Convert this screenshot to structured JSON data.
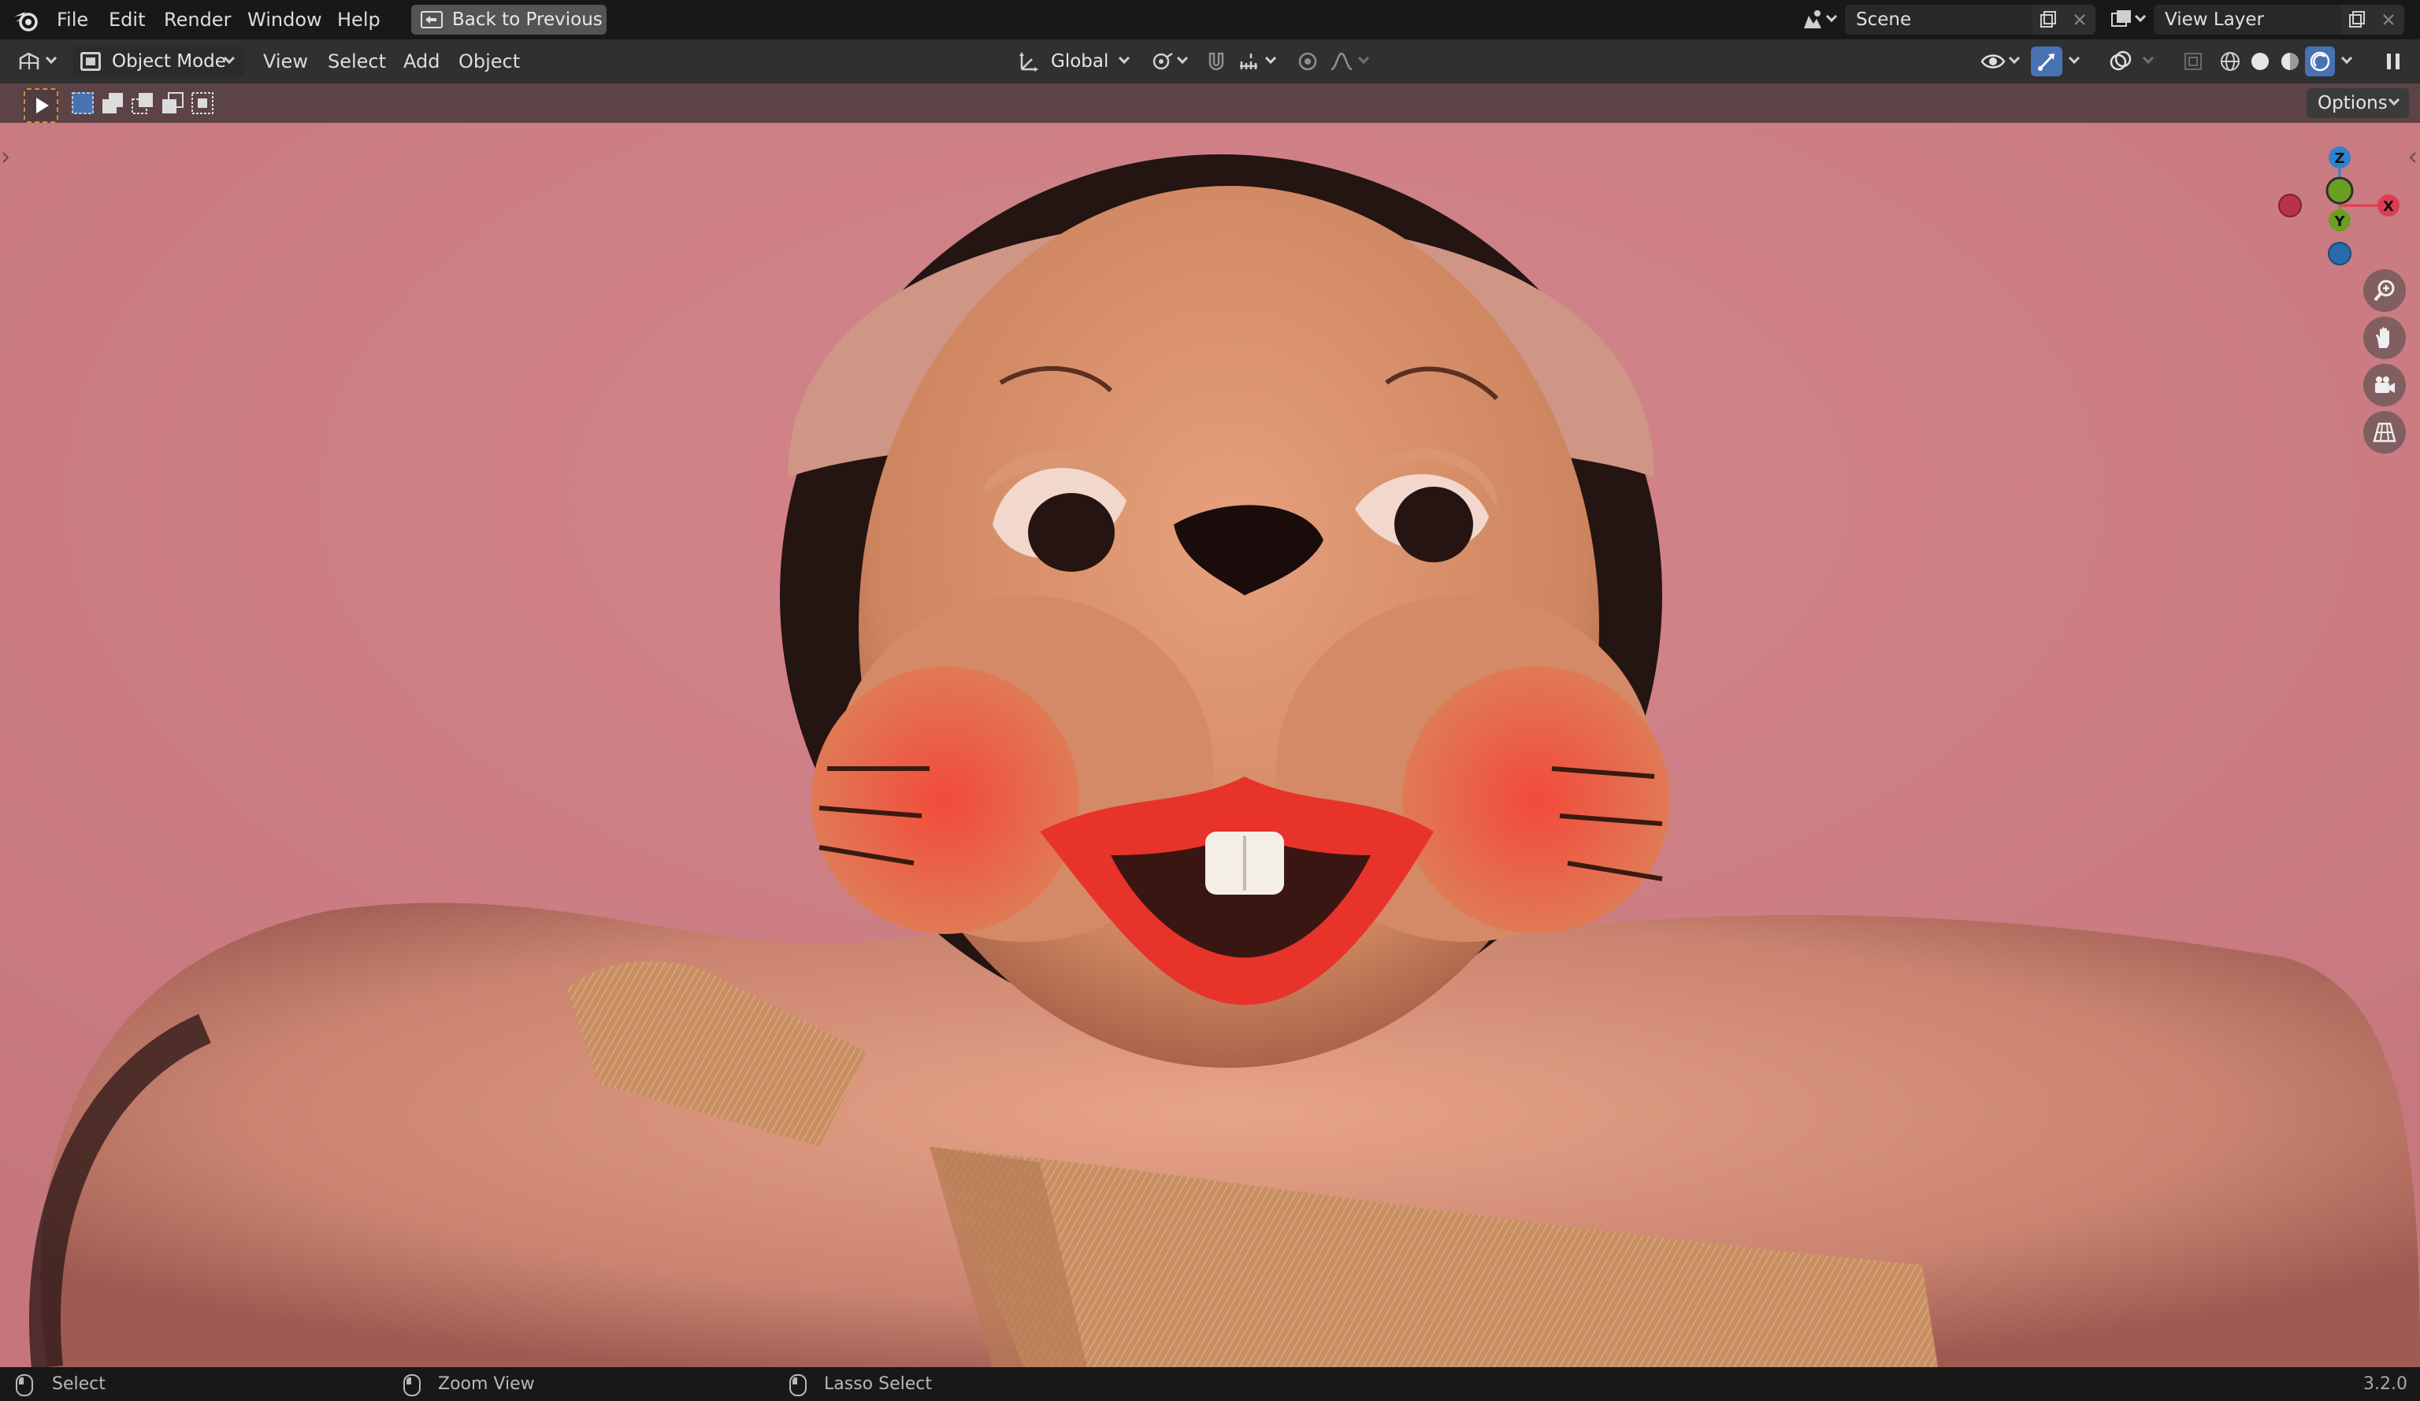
{
  "topbar": {
    "menus": [
      "File",
      "Edit",
      "Render",
      "Window",
      "Help"
    ],
    "back_button": "Back to Previous",
    "scene_label": "Scene",
    "view_layer_label": "View Layer"
  },
  "header": {
    "mode": "Object Mode",
    "menus": [
      "View",
      "Select",
      "Add",
      "Object"
    ],
    "transform_orientation": "Global"
  },
  "tool_settings": {
    "options_label": "Options"
  },
  "viewport": {
    "gizmo_axes": [
      "Z",
      "Y",
      "X"
    ],
    "background_color": "#c97a80",
    "navigation": [
      "zoom-icon",
      "pan-hand-icon",
      "camera-icon",
      "grid-icon"
    ]
  },
  "statusbar": {
    "items": [
      "Select",
      "Zoom View",
      "Lasso Select"
    ],
    "version": "3.2.0"
  },
  "colors": {
    "accent_blue": "#4772b3",
    "axis_x": "#e03b52",
    "axis_y": "#6b9e22",
    "axis_z": "#2f82d0",
    "tool_header": "#5c4345"
  }
}
